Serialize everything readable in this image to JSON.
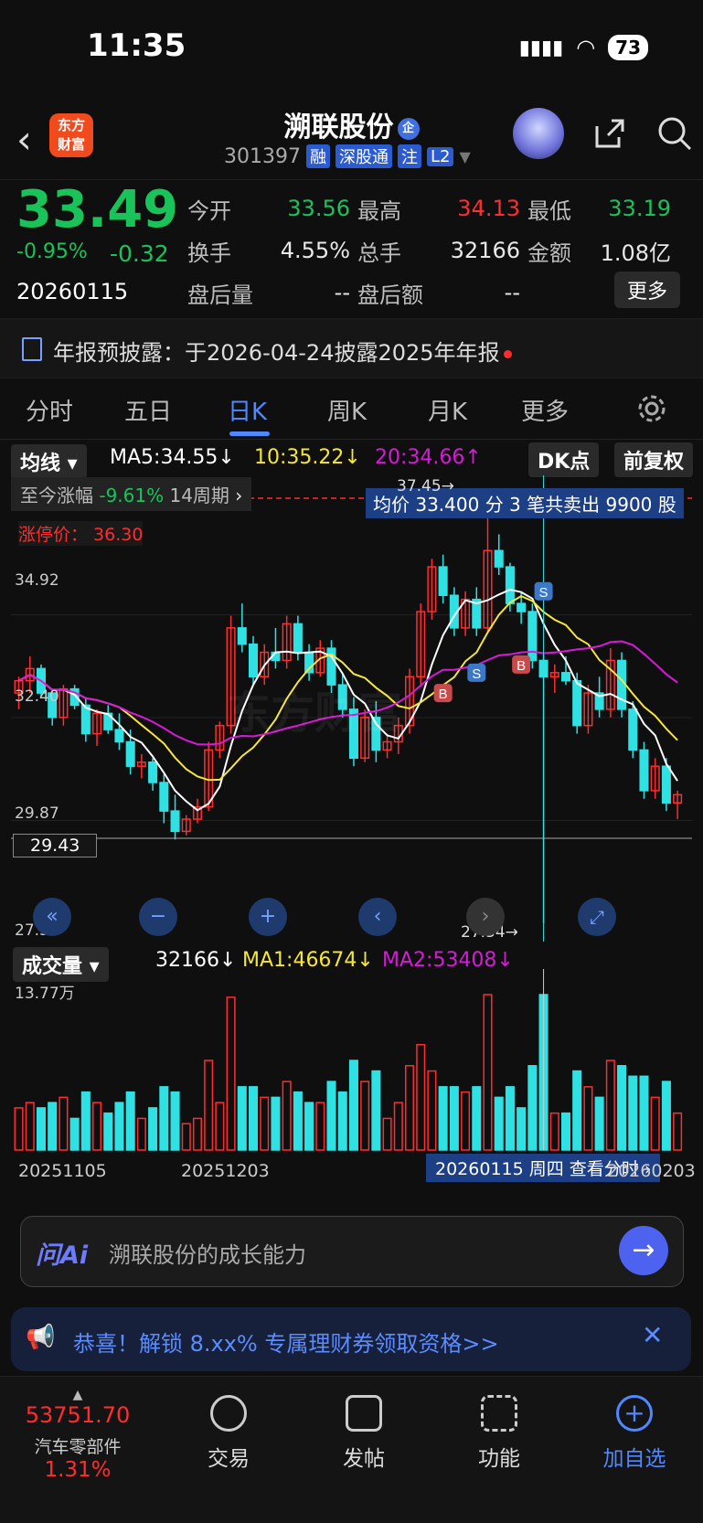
{
  "status_bar": {
    "time": "11:35",
    "battery": "73"
  },
  "header": {
    "logo_line1": "东方",
    "logo_line2": "财富",
    "stock_name": "溯联股份",
    "badge": "企",
    "code": "301397",
    "tags": [
      "融",
      "深股通",
      "注",
      "L2"
    ]
  },
  "quote": {
    "price": "33.49",
    "change_pct": "-0.95%",
    "change": "-0.32",
    "date": "20260115",
    "fields": [
      [
        {
          "label": "今开",
          "value": "33.56",
          "color": "#19c35a"
        },
        {
          "label": "最高",
          "value": "34.13",
          "color": "#ff2d2d"
        },
        {
          "label": "最低",
          "value": "33.19",
          "color": "#19c35a"
        }
      ],
      [
        {
          "label": "换手",
          "value": "4.55%",
          "color": "#ffffff"
        },
        {
          "label": "总手",
          "value": "32166",
          "color": "#ffffff"
        },
        {
          "label": "金额",
          "value": "1.08亿",
          "color": "#ffffff"
        }
      ],
      [
        {
          "label": "盘后量",
          "value": "--",
          "color": "#ffffff"
        },
        {
          "label": "盘后额",
          "value": "--",
          "color": "#ffffff"
        }
      ]
    ],
    "more_label": "更多"
  },
  "notice": {
    "text": "年报预披露：于2026-04-24披露2025年年报"
  },
  "tabs": [
    "分时",
    "五日",
    "日K",
    "周K",
    "月K",
    "更多"
  ],
  "indicator_bar": {
    "selector": "均线",
    "ma5": "MA5:34.55↓",
    "ma10": "10:35.22↓",
    "ma20": "20:34.66↑",
    "dk": "DK点",
    "adjust": "前复权"
  },
  "chart_overlay": {
    "range_label": "至今涨幅",
    "range_value": "-9.61%",
    "range_period": "14周期",
    "tooltip": "均价 33.400 分 3 笔共卖出 9900 股",
    "limit_up": "涨停价： 36.30",
    "high_label": "37.45→",
    "low_label": "27.34→",
    "crosshair_price": "29.43",
    "y_ticks": [
      "34.92",
      "32.40",
      "29.87",
      "27.34"
    ],
    "watermark": "东方财富"
  },
  "chart_data": {
    "type": "candlestick",
    "ylim": [
      27.34,
      37.45
    ],
    "candles": [
      [
        33.0,
        33.4,
        32.6,
        33.3
      ],
      [
        33.3,
        33.9,
        33.0,
        33.6
      ],
      [
        33.6,
        33.7,
        32.9,
        33.0
      ],
      [
        33.0,
        33.1,
        32.2,
        32.4
      ],
      [
        32.4,
        33.2,
        32.2,
        33.1
      ],
      [
        33.1,
        33.2,
        32.6,
        32.7
      ],
      [
        32.7,
        32.9,
        31.8,
        32.0
      ],
      [
        32.0,
        32.6,
        31.7,
        32.5
      ],
      [
        32.5,
        32.7,
        32.0,
        32.1
      ],
      [
        32.1,
        32.5,
        31.6,
        31.8
      ],
      [
        31.8,
        32.1,
        31.0,
        31.2
      ],
      [
        31.2,
        31.5,
        30.9,
        31.3
      ],
      [
        31.3,
        31.4,
        30.6,
        30.8
      ],
      [
        30.8,
        31.0,
        29.8,
        30.1
      ],
      [
        30.1,
        30.5,
        29.4,
        29.6
      ],
      [
        29.6,
        30.0,
        29.5,
        29.9
      ],
      [
        29.9,
        30.4,
        29.8,
        30.2
      ],
      [
        30.2,
        31.8,
        30.1,
        31.6
      ],
      [
        31.6,
        32.3,
        31.4,
        32.2
      ],
      [
        32.2,
        34.9,
        32.0,
        34.6
      ],
      [
        34.6,
        35.2,
        34.0,
        34.2
      ],
      [
        34.2,
        34.4,
        33.2,
        33.4
      ],
      [
        33.4,
        34.2,
        33.2,
        34.0
      ],
      [
        34.0,
        34.6,
        33.6,
        33.8
      ],
      [
        33.8,
        34.9,
        33.6,
        34.7
      ],
      [
        34.7,
        34.9,
        33.8,
        34.0
      ],
      [
        34.0,
        34.2,
        33.3,
        33.5
      ],
      [
        33.5,
        34.3,
        33.4,
        34.1
      ],
      [
        34.1,
        34.3,
        33.0,
        33.2
      ],
      [
        33.2,
        33.5,
        32.4,
        32.6
      ],
      [
        32.6,
        32.9,
        31.2,
        31.4
      ],
      [
        31.4,
        32.6,
        31.3,
        32.4
      ],
      [
        32.4,
        32.8,
        31.3,
        31.6
      ],
      [
        31.6,
        32.0,
        31.4,
        31.8
      ],
      [
        31.8,
        32.4,
        31.5,
        32.2
      ],
      [
        32.2,
        33.6,
        32.0,
        33.4
      ],
      [
        33.4,
        35.2,
        33.2,
        35.0
      ],
      [
        35.0,
        36.3,
        34.8,
        36.1
      ],
      [
        36.1,
        36.4,
        35.2,
        35.4
      ],
      [
        35.4,
        35.6,
        34.4,
        34.6
      ],
      [
        34.6,
        35.5,
        34.4,
        35.3
      ],
      [
        35.3,
        35.6,
        34.4,
        34.6
      ],
      [
        34.6,
        37.45,
        34.5,
        36.5
      ],
      [
        36.5,
        36.9,
        35.9,
        36.1
      ],
      [
        36.1,
        36.2,
        35.0,
        35.2
      ],
      [
        35.2,
        35.5,
        34.7,
        35.0
      ],
      [
        35.0,
        35.2,
        33.6,
        33.8
      ],
      [
        33.8,
        34.0,
        27.34,
        33.4
      ],
      [
        33.4,
        33.7,
        33.0,
        33.5
      ],
      [
        33.5,
        33.9,
        33.2,
        33.3
      ],
      [
        33.3,
        33.5,
        32.0,
        32.2
      ],
      [
        32.2,
        33.2,
        32.0,
        33.0
      ],
      [
        33.0,
        33.4,
        32.4,
        32.6
      ],
      [
        32.6,
        34.1,
        32.4,
        33.8
      ],
      [
        33.8,
        34.0,
        32.4,
        32.6
      ],
      [
        32.6,
        32.8,
        31.4,
        31.6
      ],
      [
        31.6,
        31.8,
        30.4,
        30.6
      ],
      [
        30.6,
        31.4,
        30.4,
        31.2
      ],
      [
        31.2,
        31.4,
        30.1,
        30.3
      ],
      [
        30.3,
        30.6,
        29.9,
        30.5
      ]
    ],
    "volume_ticks": [
      "13.77万"
    ],
    "volume_dates": [
      "20251105",
      "20251203",
      "20260115 周四 查看分时",
      "20260203"
    ],
    "volume_legend": {
      "selector": "成交量",
      "vol": "32166↓",
      "ma1": "MA1:46674↓",
      "ma2": "MA2:53408↓"
    }
  },
  "ai_bar": {
    "brand": "问Ai",
    "placeholder": "溯联股份的成长能力"
  },
  "promo": {
    "text": "恭喜！解锁 8.xx% 专属理财券领取资格>>"
  },
  "bottom_nav": {
    "index_value": "53751.70",
    "index_name": "汽车零部件",
    "index_change": "1.31%",
    "items": [
      "交易",
      "发帖",
      "功能",
      "加自选"
    ]
  },
  "colors": {
    "up": "#ff2d2d",
    "down": "#19c35a",
    "cyan": "#30e1e3",
    "accent": "#4f88ff",
    "ma5": "#ffffff",
    "ma10": "#f5e63c",
    "ma20": "#d71ad7"
  }
}
